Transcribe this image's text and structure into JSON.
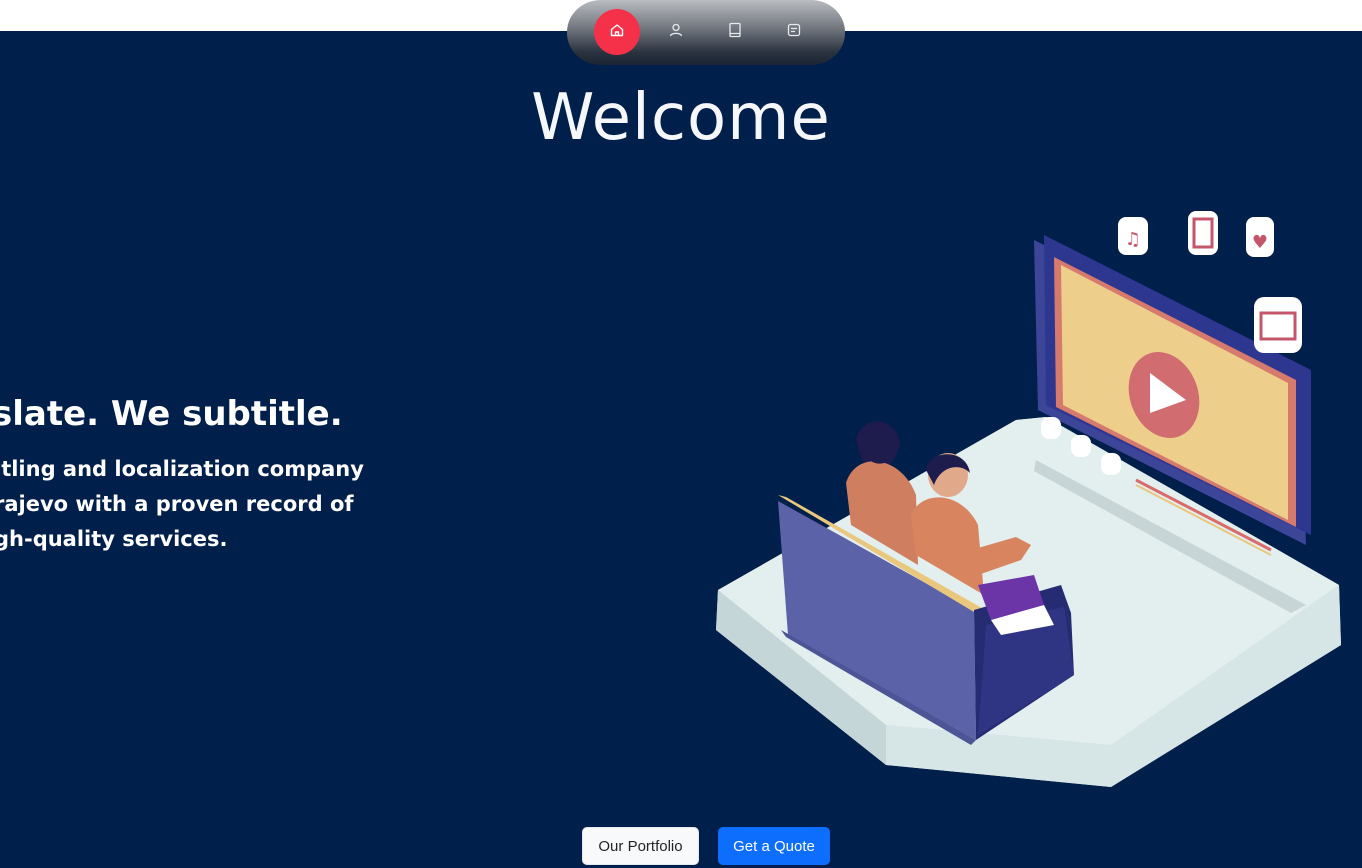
{
  "nav": {
    "items": [
      {
        "name": "home",
        "icon": "home-icon",
        "active": true
      },
      {
        "name": "about",
        "icon": "user-icon",
        "active": false
      },
      {
        "name": "portfolio",
        "icon": "book-icon",
        "active": false
      },
      {
        "name": "contact",
        "icon": "message-icon",
        "active": false
      }
    ],
    "active_color": "#f5314a"
  },
  "hero": {
    "title": "Welcome",
    "headline": "slate. We subtitle.",
    "description_lines": [
      "itling and localization company",
      "rajevo with a proven record of",
      "gh-quality services."
    ],
    "illustration": "couple-watching-tv-illustration",
    "background_color": "#001f4a"
  },
  "buttons": {
    "portfolio_label": "Our Portfolio",
    "quote_label": "Get a Quote"
  }
}
